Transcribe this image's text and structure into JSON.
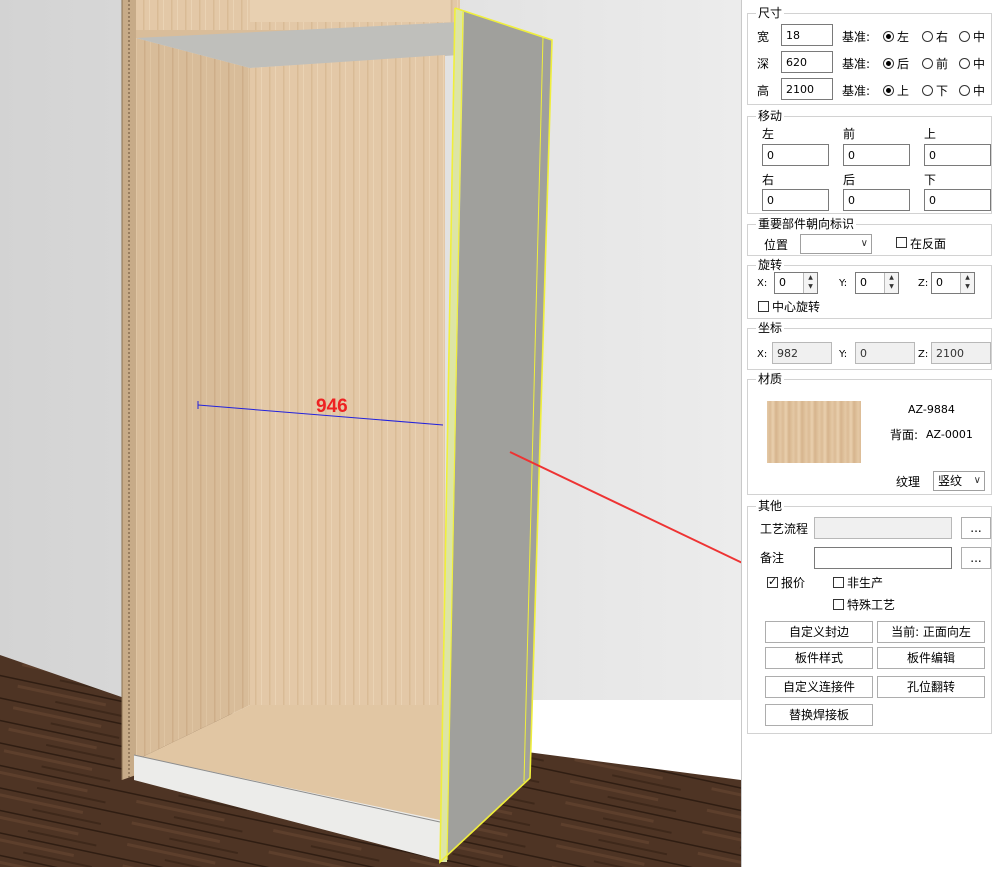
{
  "viewport": {
    "dimension_value": "946",
    "colors": {
      "wall": "#dedede",
      "floor": "#4b3222",
      "wood": "#e3c8a7",
      "side_panel": "#a0a09c",
      "highlight": "#f0ef3c",
      "dimension_line": "#2222dd",
      "dimension_text": "#ee2222",
      "arrow": "#ee3333"
    }
  },
  "panel": {
    "size": {
      "title": "尺寸",
      "rows": [
        {
          "label": "宽",
          "value": "18",
          "base_label": "基准:",
          "options": [
            "左",
            "右",
            "中"
          ],
          "selected": 0
        },
        {
          "label": "深",
          "value": "620",
          "base_label": "基准:",
          "options": [
            "后",
            "前",
            "中"
          ],
          "selected": 0
        },
        {
          "label": "高",
          "value": "2100",
          "base_label": "基准:",
          "options": [
            "上",
            "下",
            "中"
          ],
          "selected": 0
        }
      ]
    },
    "move": {
      "title": "移动",
      "fields": [
        {
          "label": "左",
          "value": "0"
        },
        {
          "label": "前",
          "value": "0"
        },
        {
          "label": "上",
          "value": "0"
        },
        {
          "label": "右",
          "value": "0"
        },
        {
          "label": "后",
          "value": "0"
        },
        {
          "label": "下",
          "value": "0"
        }
      ]
    },
    "orientation": {
      "title": "重要部件朝向标识",
      "position_label": "位置",
      "position_value": "",
      "reverse_label": "在反面"
    },
    "rotate": {
      "title": "旋转",
      "axes": [
        {
          "label": "X:",
          "value": "0"
        },
        {
          "label": "Y:",
          "value": "0"
        },
        {
          "label": "Z:",
          "value": "0"
        }
      ],
      "center_label": "中心旋转"
    },
    "coords": {
      "title": "坐标",
      "axes": [
        {
          "label": "X:",
          "value": "982"
        },
        {
          "label": "Y:",
          "value": "0"
        },
        {
          "label": "Z:",
          "value": "2100"
        }
      ]
    },
    "material": {
      "title": "材质",
      "code": "AZ-9884",
      "back_label": "背面:",
      "back_code": "AZ-0001",
      "grain_label": "纹理",
      "grain_value": "竖纹"
    },
    "other": {
      "title": "其他",
      "process_label": "工艺流程",
      "process_value": "",
      "note_label": "备注",
      "note_value": "",
      "more_label": "...",
      "checkboxes": [
        {
          "label": "报价",
          "checked": true
        },
        {
          "label": "非生产",
          "checked": false
        },
        {
          "label": "特殊工艺",
          "checked": false
        }
      ],
      "buttons": [
        "自定义封边",
        "当前: 正面向左",
        "板件样式",
        "板件编辑",
        "自定义连接件",
        "孔位翻转",
        "替换焊接板"
      ]
    }
  }
}
